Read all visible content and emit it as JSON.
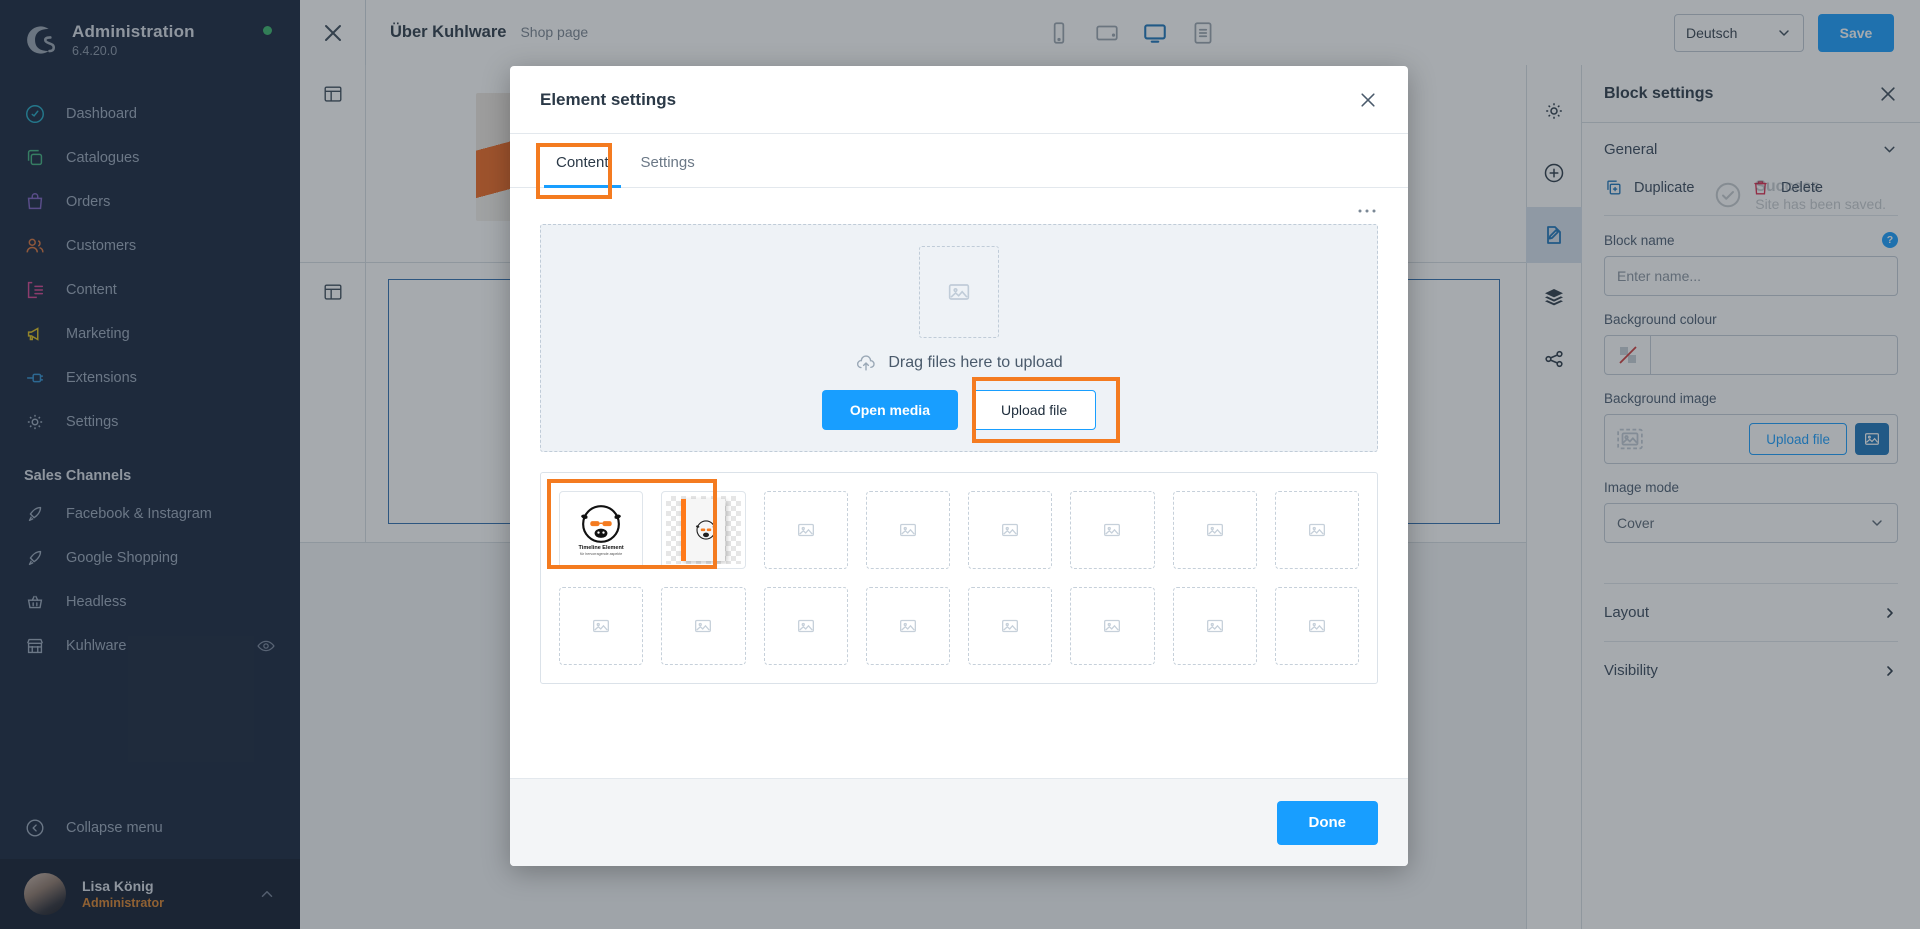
{
  "sidebar": {
    "app_title": "Administration",
    "version": "6.4.20.0",
    "status_icon": "status-dot-online",
    "logo_icon": "shopware-logo-icon",
    "items": [
      {
        "label": "Dashboard",
        "icon": "dashboard-icon",
        "color": "#1fa8c3"
      },
      {
        "label": "Catalogues",
        "icon": "catalogues-icon",
        "color": "#3fb27f"
      },
      {
        "label": "Orders",
        "icon": "orders-icon",
        "color": "#7b5fc0"
      },
      {
        "label": "Customers",
        "icon": "customers-icon",
        "color": "#d9733a"
      },
      {
        "label": "Content",
        "icon": "content-icon",
        "color": "#d4438f"
      },
      {
        "label": "Marketing",
        "icon": "marketing-icon",
        "color": "#e0c01a"
      },
      {
        "label": "Extensions",
        "icon": "extensions-icon",
        "color": "#2f8fd0"
      },
      {
        "label": "Settings",
        "icon": "gear-icon",
        "color": "#9aa7bb"
      }
    ],
    "section_label": "Sales Channels",
    "channels": [
      {
        "label": "Facebook & Instagram",
        "icon": "rocket-icon"
      },
      {
        "label": "Google Shopping",
        "icon": "rocket-icon"
      },
      {
        "label": "Headless",
        "icon": "basket-icon"
      },
      {
        "label": "Kuhlware",
        "icon": "storefront-icon",
        "trailing_icon": "eye-icon"
      }
    ],
    "collapse_label": "Collapse menu",
    "collapse_icon": "collapse-arrow-icon",
    "user_name": "Lisa König",
    "user_role": "Administrator",
    "user_caret_icon": "chevron-up-icon"
  },
  "topbar": {
    "close_icon": "close-icon",
    "title": "Über Kuhlware",
    "subtitle": "Shop page",
    "devices": [
      {
        "icon": "mobile-icon",
        "active": false
      },
      {
        "icon": "tablet-icon",
        "active": false
      },
      {
        "icon": "desktop-icon",
        "active": true
      },
      {
        "icon": "form-icon",
        "active": false
      }
    ],
    "language": "Deutsch",
    "language_caret_icon": "chevron-down-icon",
    "save_label": "Save"
  },
  "canvas": {
    "block_handle_icon": "block-layout-icon",
    "rows": 2
  },
  "rail": {
    "items": [
      {
        "icon": "gear-icon",
        "active": false
      },
      {
        "icon": "plus-circle-icon",
        "active": false
      },
      {
        "icon": "edit-document-icon",
        "active": true
      },
      {
        "icon": "layers-icon",
        "active": false
      },
      {
        "icon": "share-icon",
        "active": false
      }
    ]
  },
  "toast": {
    "title": "Success",
    "message": "Site has been saved.",
    "icon": "check-circle-icon"
  },
  "block_settings": {
    "title": "Block settings",
    "close_icon": "close-icon",
    "general_label": "General",
    "general_caret_icon": "chevron-down-icon",
    "duplicate_label": "Duplicate",
    "duplicate_icon": "duplicate-icon",
    "delete_label": "Delete",
    "delete_icon": "trash-icon",
    "block_name_label": "Block name",
    "block_name_help_icon": "help-icon",
    "block_name_help_char": "?",
    "block_name_value": "",
    "block_name_placeholder": "Enter name...",
    "background_colour_label": "Background colour",
    "background_colour_value": "",
    "background_colour_swatch_icon": "no-colour-icon",
    "background_image_label": "Background image",
    "background_image_placeholder_icon": "image-placeholder-icon",
    "background_image_upload_label": "Upload file",
    "background_image_media_icon": "open-media-icon",
    "image_mode_label": "Image mode",
    "image_mode_value": "Cover",
    "image_mode_caret_icon": "chevron-down-icon",
    "layout_label": "Layout",
    "layout_caret_icon": "chevron-right-icon",
    "visibility_label": "Visibility",
    "visibility_caret_icon": "chevron-right-icon"
  },
  "modal": {
    "title": "Element settings",
    "close_icon": "close-icon",
    "tabs": [
      {
        "label": "Content",
        "active": true
      },
      {
        "label": "Settings",
        "active": false
      }
    ],
    "context_menu_icon": "ellipsis-icon",
    "dropzone": {
      "placeholder_icon": "image-placeholder-icon",
      "upload_icon": "cloud-upload-icon",
      "text": "Drag files here to upload",
      "open_media_label": "Open media",
      "upload_file_label": "Upload file"
    },
    "gallery": {
      "items": [
        {
          "type": "image",
          "icon": "cow-logo-thumbnail",
          "caption_title": "Timeline Element",
          "caption_sub": "für hervorragende aspekte"
        },
        {
          "type": "image",
          "icon": "cow-book-thumbnail"
        },
        {
          "type": "empty",
          "icon": "image-placeholder-icon"
        },
        {
          "type": "empty",
          "icon": "image-placeholder-icon"
        },
        {
          "type": "empty",
          "icon": "image-placeholder-icon"
        },
        {
          "type": "empty",
          "icon": "image-placeholder-icon"
        },
        {
          "type": "empty",
          "icon": "image-placeholder-icon"
        },
        {
          "type": "empty",
          "icon": "image-placeholder-icon"
        },
        {
          "type": "empty",
          "icon": "image-placeholder-icon"
        },
        {
          "type": "empty",
          "icon": "image-placeholder-icon"
        },
        {
          "type": "empty",
          "icon": "image-placeholder-icon"
        },
        {
          "type": "empty",
          "icon": "image-placeholder-icon"
        },
        {
          "type": "empty",
          "icon": "image-placeholder-icon"
        },
        {
          "type": "empty",
          "icon": "image-placeholder-icon"
        },
        {
          "type": "empty",
          "icon": "image-placeholder-icon"
        },
        {
          "type": "empty",
          "icon": "image-placeholder-icon"
        }
      ]
    },
    "done_label": "Done"
  },
  "colors": {
    "accent_blue": "#189eff",
    "highlight_orange": "#f47b20",
    "sidebar_bg": "#16243b",
    "save_blue": "#1a74bb"
  }
}
